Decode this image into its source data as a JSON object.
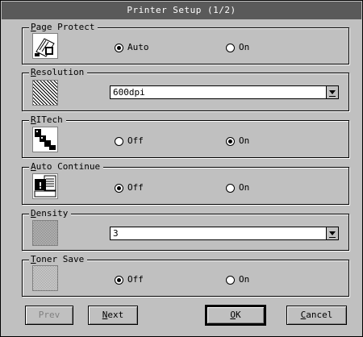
{
  "window": {
    "title": "Printer Setup (1/2)"
  },
  "groups": {
    "page_protect": {
      "label_first": "P",
      "label_rest": "age Protect",
      "icon": "page-protect-icon",
      "options": [
        {
          "label": "Auto",
          "checked": true
        },
        {
          "label": "On",
          "checked": false
        }
      ]
    },
    "resolution": {
      "label_first": "R",
      "label_rest": "esolution",
      "icon": "resolution-pattern-icon",
      "value": "600dpi"
    },
    "ritech": {
      "label_first": "R",
      "label_rest": "ITech",
      "icon": "ritech-icon",
      "options": [
        {
          "label": "Off",
          "checked": false
        },
        {
          "label": "On",
          "checked": true
        }
      ]
    },
    "auto_continue": {
      "label_first": "A",
      "label_rest": "uto Continue",
      "icon": "auto-continue-icon",
      "options": [
        {
          "label": "Off",
          "checked": true
        },
        {
          "label": "On",
          "checked": false
        }
      ]
    },
    "density": {
      "label_first": "D",
      "label_rest": "ensity",
      "icon": "density-icon",
      "value": "3"
    },
    "toner_save": {
      "label_first": "T",
      "label_rest": "oner Save",
      "icon": "toner-save-icon",
      "options": [
        {
          "label": "Off",
          "checked": true
        },
        {
          "label": "On",
          "checked": false
        }
      ]
    }
  },
  "buttons": {
    "prev": {
      "label": "Prev",
      "disabled": true
    },
    "next": {
      "label_first": "N",
      "label_rest": "ext"
    },
    "ok": {
      "label_first": "O",
      "label_rest": "K"
    },
    "cancel": {
      "label_first": "C",
      "label_rest": "ancel"
    }
  }
}
